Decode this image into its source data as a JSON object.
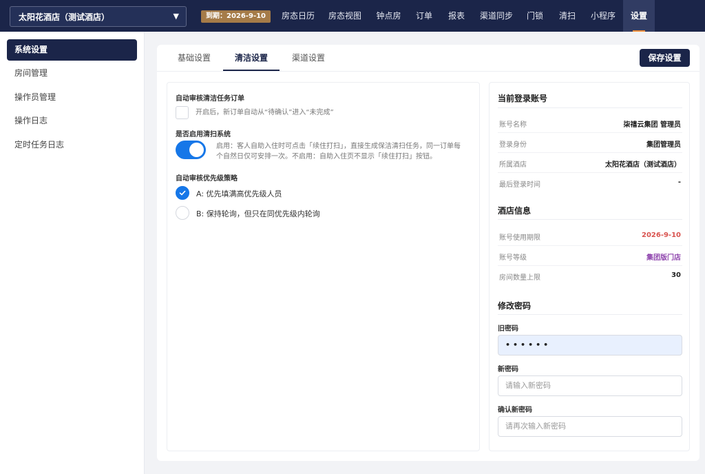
{
  "topbar": {
    "hotel_name": "太阳花酒店（测试酒店）",
    "caret": "▼",
    "expire": "到期：2026-9-10",
    "nav": [
      "房态日历",
      "房态视图",
      "钟点房",
      "订单",
      "报表",
      "渠道同步",
      "门锁",
      "清扫",
      "小程序",
      "设置"
    ],
    "active_nav": "设置"
  },
  "sidebar": {
    "items": [
      "系统设置",
      "房间管理",
      "操作员管理",
      "操作日志",
      "定时任务日志"
    ],
    "active": "系统设置"
  },
  "tabs": {
    "items": [
      "基础设置",
      "清洁设置",
      "渠道设置"
    ],
    "active": "清洁设置",
    "save_label": "保存设置"
  },
  "clean_settings": {
    "auto_audit_label": "自动审核清洁任务订单",
    "auto_audit_checked": false,
    "auto_audit_hint": "开启后，新订单自动从“待确认”进入“未完成”",
    "enable_clean_label": "是否启用清扫系统",
    "enable_clean_on": true,
    "enable_clean_hint_line1": "启用：客人自助入住时可点击「续住打扫」，直接生成保洁清扫任务，同一订单每",
    "enable_clean_hint_line2": "个自然日仅可安排一次。不启用：自助入住页不显示「续住打扫」按钮。",
    "priority_label": "自动审核优先级策略",
    "priority_options": [
      {
        "label": "A: 优先填满高优先级人员",
        "checked": true
      },
      {
        "label": "B: 保持轮询，但只在同优先级内轮询",
        "checked": false
      }
    ]
  },
  "account": {
    "title": "当前登录账号",
    "rows": [
      {
        "key": "账号名称",
        "value": "柒禧云集团 管理员"
      },
      {
        "key": "登录身份",
        "value": "集团管理员"
      },
      {
        "key": "所属酒店",
        "value": "太阳花酒店（测试酒店）"
      },
      {
        "key": "最后登录时间",
        "value": "-"
      }
    ]
  },
  "hotel_info": {
    "title": "酒店信息",
    "rows": [
      {
        "key": "账号使用期限",
        "value": "2026-9-10",
        "color": "#d9534f"
      },
      {
        "key": "账号等级",
        "value": "集团版门店",
        "color": "#8e44ad"
      },
      {
        "key": "房间数量上限",
        "value": "30"
      }
    ]
  },
  "password": {
    "title": "修改密码",
    "old_label": "旧密码",
    "old_value": "••••••",
    "new_label": "新密码",
    "new_placeholder": "请输入新密码",
    "confirm_label": "确认新密码",
    "confirm_placeholder": "请再次输入新密码"
  },
  "colors": {
    "brand": "#1b2549",
    "accent": "#1677e8",
    "expire_badge": "#a57b48"
  }
}
